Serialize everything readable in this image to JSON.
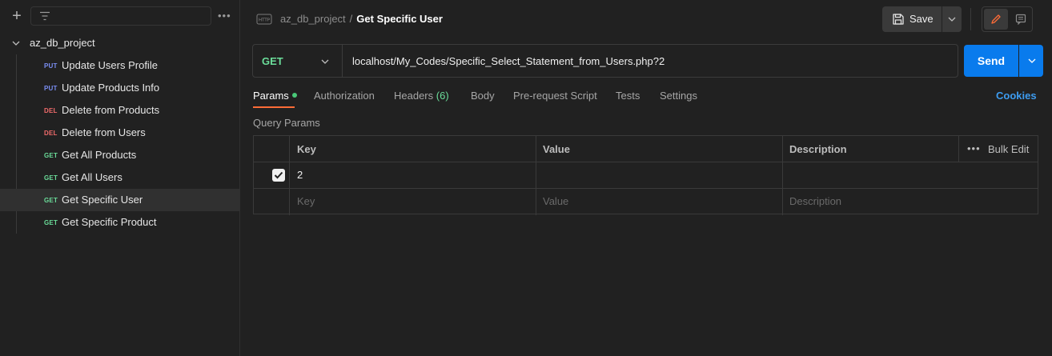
{
  "sidebar": {
    "new_icon": "plus-icon",
    "filter_icon": "filter-icon",
    "search_value": "",
    "more_icon": "more-horizontal-icon",
    "more_text": "•••",
    "collection": {
      "name": "az_db_project",
      "expanded": true
    },
    "requests": [
      {
        "method": "PUT",
        "name": "Update Users Profile",
        "color": "#7b8ff5"
      },
      {
        "method": "PUT",
        "name": "Update Products Info",
        "color": "#7b8ff5"
      },
      {
        "method": "DEL",
        "name": "Delete from Products",
        "color": "#f06b6b"
      },
      {
        "method": "DEL",
        "name": "Delete from Users",
        "color": "#f06b6b"
      },
      {
        "method": "GET",
        "name": "Get All Products",
        "color": "#6bdd9a"
      },
      {
        "method": "GET",
        "name": "Get All Users",
        "color": "#6bdd9a"
      },
      {
        "method": "GET",
        "name": "Get Specific User",
        "color": "#6bdd9a",
        "active": true
      },
      {
        "method": "GET",
        "name": "Get Specific Product",
        "color": "#6bdd9a"
      }
    ]
  },
  "header": {
    "breadcrumb_parent": "az_db_project",
    "breadcrumb_sep": "/",
    "breadcrumb_current": "Get Specific User",
    "save_label": "Save"
  },
  "request": {
    "method": "GET",
    "url": "localhost/My_Codes/Specific_Select_Statement_from_Users.php?2",
    "send_label": "Send"
  },
  "tabs": [
    {
      "label": "Params",
      "active": true,
      "dot": true
    },
    {
      "label": "Authorization"
    },
    {
      "label": "Headers",
      "count": "(6)"
    },
    {
      "label": "Body"
    },
    {
      "label": "Pre-request Script"
    },
    {
      "label": "Tests"
    },
    {
      "label": "Settings"
    }
  ],
  "cookies_label": "Cookies",
  "query_params": {
    "title": "Query Params",
    "columns": {
      "key": "Key",
      "value": "Value",
      "description": "Description"
    },
    "bulk_edit_label": "Bulk Edit",
    "bulk_dots": "•••",
    "rows": [
      {
        "checked": true,
        "key": "2",
        "value": "",
        "description": ""
      }
    ],
    "placeholders": {
      "key": "Key",
      "value": "Value",
      "description": "Description"
    }
  },
  "colors": {
    "accent_orange": "#ff6c37",
    "send_blue": "#097bed",
    "get_green": "#6bdd9a",
    "link_blue": "#3d9cf0"
  }
}
